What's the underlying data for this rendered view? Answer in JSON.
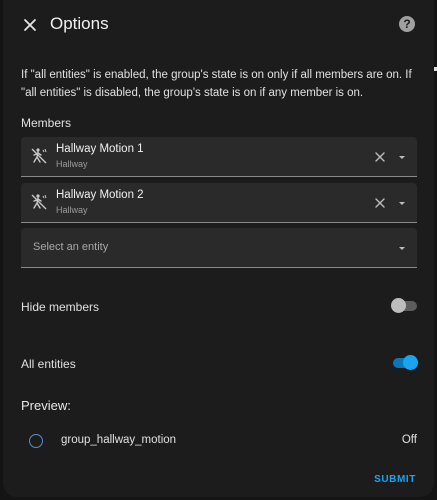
{
  "dialog": {
    "title": "Options",
    "close_icon": "close-icon",
    "help_icon": "help-icon",
    "help_glyph": "?"
  },
  "description": "If \"all entities\" is enabled, the group's state is on only if all members are on. If \"all entities\" is disabled, the group's state is on if any member is on.",
  "members": {
    "label": "Members",
    "items": [
      {
        "name": "Hallway Motion 1",
        "area": "Hallway",
        "icon": "motion-sensor-off-icon"
      },
      {
        "name": "Hallway Motion 2",
        "area": "Hallway",
        "icon": "motion-sensor-off-icon"
      }
    ],
    "select_placeholder": "Select an entity"
  },
  "hide_members": {
    "label": "Hide members",
    "enabled": false
  },
  "all_entities": {
    "label": "All entities",
    "enabled": true
  },
  "preview": {
    "heading": "Preview:",
    "entity_name": "group_hallway_motion",
    "state": "Off"
  },
  "actions": {
    "submit_label": "SUBMIT"
  },
  "colors": {
    "accent": "#1aa3f0",
    "background": "#1c1c1c",
    "field_background": "#2a2a2a",
    "text": "#e1e1e1"
  }
}
